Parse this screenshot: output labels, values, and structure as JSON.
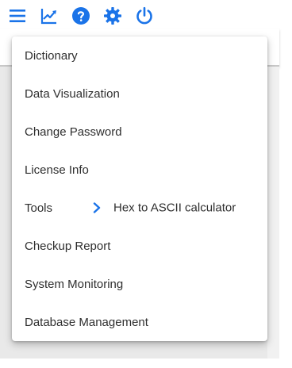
{
  "toolbar": {
    "icons": [
      {
        "name": "menu-icon",
        "color": "#1a73e8"
      },
      {
        "name": "chart-icon",
        "color": "#1a73e8"
      },
      {
        "name": "help-icon",
        "color": "#1a73e8"
      },
      {
        "name": "gear-icon",
        "color": "#1a73e8"
      },
      {
        "name": "power-icon",
        "color": "#1a73e8"
      }
    ]
  },
  "menu": {
    "items": [
      {
        "label": "Dictionary"
      },
      {
        "label": "Data Visualization"
      },
      {
        "label": "Change Password"
      },
      {
        "label": "License Info"
      },
      {
        "label": "Tools",
        "submenu_label": "Hex to ASCII calculator"
      },
      {
        "label": "Checkup Report"
      },
      {
        "label": "System Monitoring"
      },
      {
        "label": "Database Management"
      }
    ]
  },
  "colors": {
    "accent": "#1a73e8",
    "text": "#2f2f2f"
  }
}
